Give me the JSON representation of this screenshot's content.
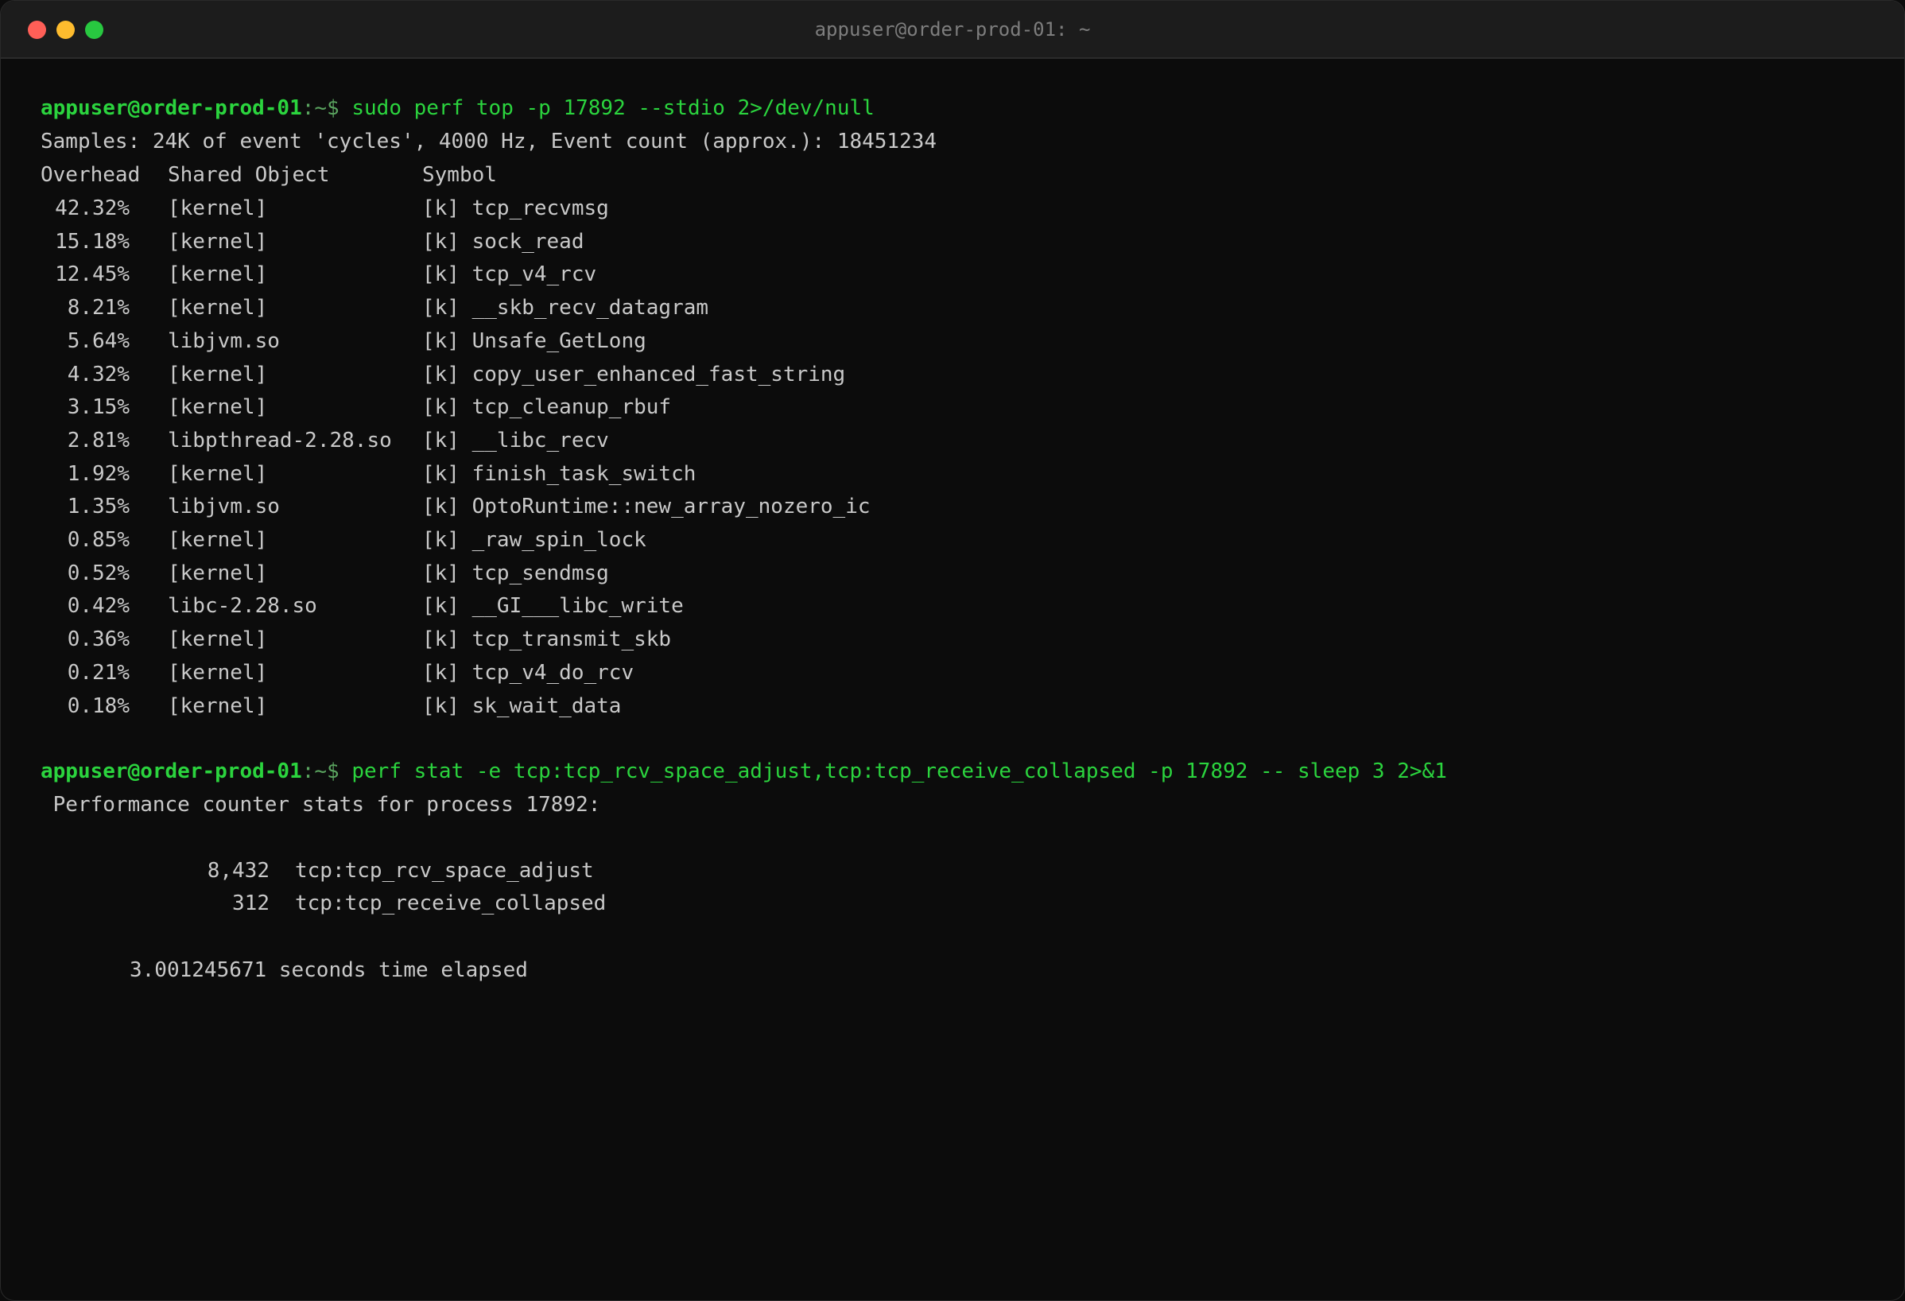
{
  "window": {
    "title": "appuser@order-prod-01: ~"
  },
  "colors": {
    "prompt_green": "#2bd43e",
    "text": "#c9c9c9",
    "background": "#0c0c0c",
    "close": "#ff5f57",
    "minimize": "#febc2e",
    "maximize": "#28c840"
  },
  "prompt": {
    "user_host": "appuser@order-prod-01",
    "path": ":~$ "
  },
  "commands": {
    "first": "sudo perf top -p 17892 --stdio 2>/dev/null",
    "second": "perf stat -e tcp:tcp_rcv_space_adjust,tcp:tcp_receive_collapsed -p 17892 -- sleep 3 2>&1"
  },
  "perf_top": {
    "samples_line": "Samples: 24K of event 'cycles', 4000 Hz, Event count (approx.): 18451234",
    "headers": {
      "overhead": "Overhead",
      "shared_object": "Shared Object",
      "symbol": "Symbol"
    },
    "rows": [
      {
        "overhead": "42.32%",
        "object": "[kernel]",
        "symbol": "[k] tcp_recvmsg"
      },
      {
        "overhead": "15.18%",
        "object": "[kernel]",
        "symbol": "[k] sock_read"
      },
      {
        "overhead": "12.45%",
        "object": "[kernel]",
        "symbol": "[k] tcp_v4_rcv"
      },
      {
        "overhead": "8.21%",
        "object": "[kernel]",
        "symbol": "[k] __skb_recv_datagram"
      },
      {
        "overhead": "5.64%",
        "object": "libjvm.so",
        "symbol": "[k] Unsafe_GetLong"
      },
      {
        "overhead": "4.32%",
        "object": "[kernel]",
        "symbol": "[k] copy_user_enhanced_fast_string"
      },
      {
        "overhead": "3.15%",
        "object": "[kernel]",
        "symbol": "[k] tcp_cleanup_rbuf"
      },
      {
        "overhead": "2.81%",
        "object": "libpthread-2.28.so",
        "symbol": "[k] __libc_recv"
      },
      {
        "overhead": "1.92%",
        "object": "[kernel]",
        "symbol": "[k] finish_task_switch"
      },
      {
        "overhead": "1.35%",
        "object": "libjvm.so",
        "symbol": "[k] OptoRuntime::new_array_nozero_ic"
      },
      {
        "overhead": "0.85%",
        "object": "[kernel]",
        "symbol": "[k] _raw_spin_lock"
      },
      {
        "overhead": "0.52%",
        "object": "[kernel]",
        "symbol": "[k] tcp_sendmsg"
      },
      {
        "overhead": "0.42%",
        "object": "libc-2.28.so",
        "symbol": "[k] __GI___libc_write"
      },
      {
        "overhead": "0.36%",
        "object": "[kernel]",
        "symbol": "[k] tcp_transmit_skb"
      },
      {
        "overhead": "0.21%",
        "object": "[kernel]",
        "symbol": "[k] tcp_v4_do_rcv"
      },
      {
        "overhead": "0.18%",
        "object": "[kernel]",
        "symbol": "[k] sk_wait_data"
      }
    ]
  },
  "perf_stat": {
    "header": " Performance counter stats for process 17892:",
    "rows": [
      {
        "count": "8,432",
        "event": "tcp:tcp_rcv_space_adjust"
      },
      {
        "count": "312",
        "event": "tcp:tcp_receive_collapsed"
      }
    ],
    "elapsed": "3.001245671 seconds time elapsed"
  }
}
